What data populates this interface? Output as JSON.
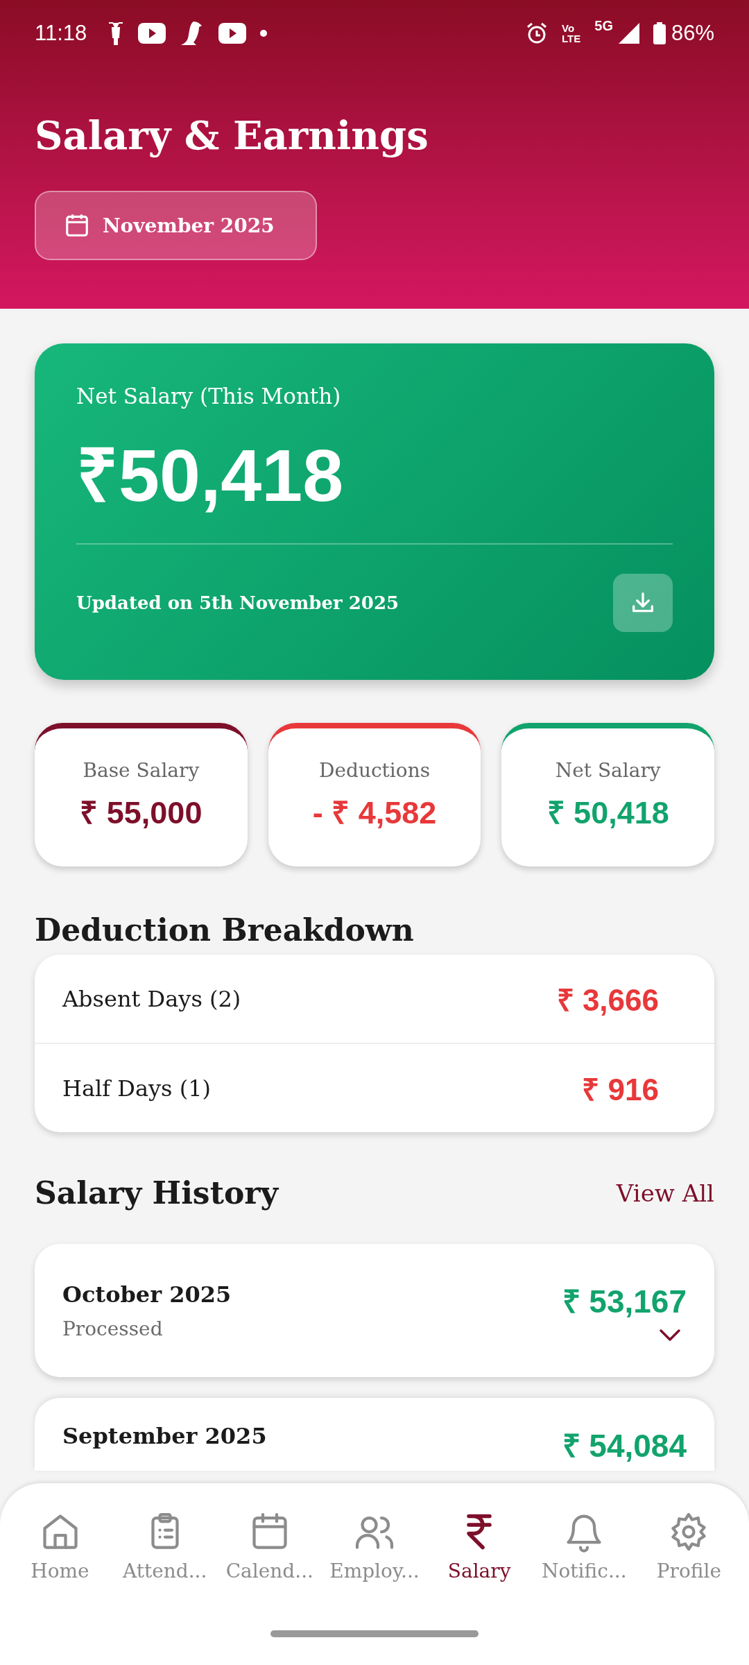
{
  "status_bar": {
    "time": "11:18",
    "volte_top": "Vo",
    "volte_bottom": "LTE",
    "network": "5G",
    "battery": "86%"
  },
  "header": {
    "title": "Salary & Earnings",
    "month": "November 2025"
  },
  "net_card": {
    "label": "Net Salary (This Month)",
    "amount": "₹50,418",
    "updated": "Updated on 5th November 2025"
  },
  "summary": [
    {
      "label": "Base Salary",
      "amount": "₹ 55,000",
      "color": "#7d0f2a"
    },
    {
      "label": "Deductions",
      "amount": "- ₹ 4,582",
      "color": "#e8383a"
    },
    {
      "label": "Net Salary",
      "amount": "₹ 50,418",
      "color": "#12a36d"
    }
  ],
  "deduction_breakdown": {
    "title": "Deduction Breakdown",
    "rows": [
      {
        "label": "Absent Days (2)",
        "amount": "₹ 3,666"
      },
      {
        "label": "Half Days (1)",
        "amount": "₹ 916"
      }
    ]
  },
  "salary_history": {
    "title": "Salary History",
    "view_all": "View All",
    "items": [
      {
        "month": "October 2025",
        "status": "Processed",
        "amount": "₹ 53,167",
        "expanded": false
      },
      {
        "month": "September 2025",
        "amount": "₹ 54,084"
      }
    ]
  },
  "nav": [
    {
      "label": "Home",
      "kind": "home",
      "selected": false
    },
    {
      "label": "Attend...",
      "kind": "clipboard",
      "selected": false
    },
    {
      "label": "Calend...",
      "kind": "calendar",
      "selected": false
    },
    {
      "label": "Employ...",
      "kind": "people",
      "selected": false
    },
    {
      "label": "Salary",
      "kind": "rupee",
      "selected": true
    },
    {
      "label": "Notific...",
      "kind": "bell",
      "selected": false
    },
    {
      "label": "Profile",
      "kind": "gear",
      "selected": false
    }
  ]
}
